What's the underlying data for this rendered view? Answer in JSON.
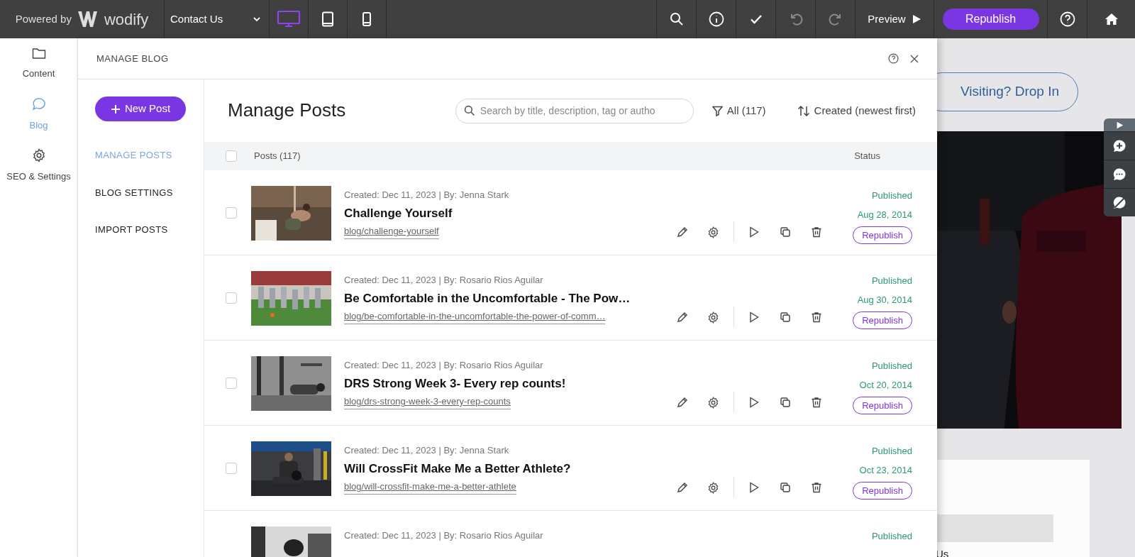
{
  "topbar": {
    "brand_prefix": "Powered by",
    "brand_name": "wodify",
    "page_select": "Contact Us",
    "devices": [
      {
        "kind": "desktop",
        "selected": true
      },
      {
        "kind": "tablet",
        "selected": false
      },
      {
        "kind": "mobile",
        "selected": false
      }
    ],
    "tools": [
      {
        "kind": "search",
        "disabled": false
      },
      {
        "kind": "info",
        "disabled": false
      },
      {
        "kind": "check",
        "disabled": false
      },
      {
        "kind": "undo",
        "disabled": true
      },
      {
        "kind": "redo",
        "disabled": true
      }
    ],
    "preview": "Preview",
    "republish": "Republish"
  },
  "rail": [
    {
      "kind": "folder",
      "label": "Content",
      "selected": false
    },
    {
      "kind": "chat",
      "label": "Blog",
      "selected": true
    },
    {
      "kind": "gear",
      "label": "SEO & Settings",
      "selected": false
    }
  ],
  "panel": {
    "title": "MANAGE BLOG",
    "new_post": "New Post",
    "nav": [
      {
        "label": "MANAGE POSTS",
        "selected": true
      },
      {
        "label": "BLOG SETTINGS",
        "selected": false
      },
      {
        "label": "IMPORT POSTS",
        "selected": false
      }
    ],
    "heading": "Manage Posts",
    "search": {
      "placeholder": "Search by title, description, tag or autho"
    },
    "filter": "All (117)",
    "sort": "Created (newest first)",
    "table": {
      "select_all": {
        "checked": false
      },
      "columns": [
        "Posts (117)",
        "Status"
      ],
      "rows": [
        {
          "checked": false,
          "meta": "Created: Dec 11, 2023 | By: Jenna Stark",
          "title": "Challenge Yourself",
          "slug": "blog/challenge-yourself",
          "status": "Published",
          "date": "Aug 28, 2014",
          "action": "Republish"
        },
        {
          "checked": false,
          "meta": "Created: Dec 11, 2023 | By: Rosario Rios Aguilar",
          "title": "Be Comfortable in the Uncomfortable - The Pow…",
          "slug": "blog/be-comfortable-in-the-uncomfortable-the-power-of-comm…",
          "status": "Published",
          "date": "Aug 30, 2014",
          "action": "Republish"
        },
        {
          "checked": false,
          "meta": "Created: Dec 11, 2023 | By: Rosario Rios Aguilar",
          "title": "DRS Strong Week 3- Every rep counts!",
          "slug": "blog/drs-strong-week-3-every-rep-counts",
          "status": "Published",
          "date": "Oct 20, 2014",
          "action": "Republish"
        },
        {
          "checked": false,
          "meta": "Created: Dec 11, 2023 | By: Jenna Stark",
          "title": "Will CrossFit Make Me a Better Athlete?",
          "slug": "blog/will-crossfit-make-me-a-better-athlete",
          "status": "Published",
          "date": "Oct 23, 2014",
          "action": "Republish"
        },
        {
          "meta": "Created: Dec 11, 2023 | By: Rosario Rios Aguilar",
          "status": "Published"
        }
      ]
    }
  },
  "site_preview": {
    "button": "Visiting? Drop In",
    "footer_text": "Us"
  }
}
